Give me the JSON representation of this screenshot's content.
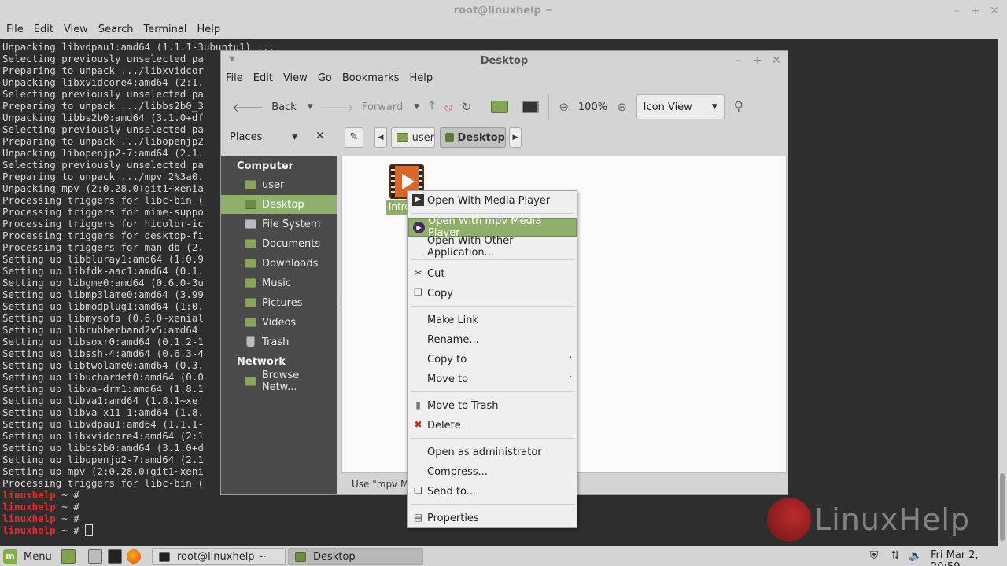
{
  "terminal": {
    "title": "root@linuxhelp ~",
    "menu": [
      "File",
      "Edit",
      "View",
      "Search",
      "Terminal",
      "Help"
    ],
    "lines": [
      "Unpacking libvdpau1:amd64 (1.1.1-3ubuntu1) ...",
      "Selecting previously unselected pa",
      "Preparing to unpack .../libxvidcor",
      "Unpacking libxvidcore4:amd64 (2:1.",
      "Selecting previously unselected pa",
      "Preparing to unpack .../libbs2b0_3",
      "Unpacking libbs2b0:amd64 (3.1.0+df",
      "Selecting previously unselected pa",
      "Preparing to unpack .../libopenjp2",
      "Unpacking libopenjp2-7:amd64 (2.1.",
      "Selecting previously unselected pa",
      "Preparing to unpack .../mpv_2%3a0.",
      "Unpacking mpv (2:0.28.0+git1~xenia",
      "Processing triggers for libc-bin (",
      "Processing triggers for mime-suppo",
      "Processing triggers for hicolor-ic",
      "Processing triggers for desktop-fi",
      "Processing triggers for man-db (2.",
      "Setting up libbluray1:amd64 (1:0.9",
      "Setting up libfdk-aac1:amd64 (0.1.",
      "Setting up libgme0:amd64 (0.6.0-3u",
      "Setting up libmp3lame0:amd64 (3.99",
      "Setting up libmodplug1:amd64 (1:0.",
      "Setting up libmysofa (0.6.0~xenial",
      "Setting up librubberband2v5:amd64 ",
      "Setting up libsoxr0:amd64 (0.1.2-1",
      "Setting up libssh-4:amd64 (0.6.3-4",
      "Setting up libtwolame0:amd64 (0.3.",
      "Setting up libuchardet0:amd64 (0.0",
      "Setting up libva-drm1:amd64 (1.8.1",
      "Setting up libva1:amd64 (1.8.1~xe",
      "Setting up libva-x11-1:amd64 (1.8.",
      "Setting up libvdpau1:amd64 (1.1.1-",
      "Setting up libxvidcore4:amd64 (2:1",
      "Setting up libbs2b0:amd64 (3.1.0+d",
      "Setting up libopenjp2-7:amd64 (2.1",
      "Setting up mpv (2:0.28.0+git1~xeni",
      "Processing triggers for libc-bin ("
    ],
    "prompt_user": "linuxhelp",
    "prompt_tail": " ~ #"
  },
  "file_manager": {
    "title": "Desktop",
    "menu": [
      "File",
      "Edit",
      "View",
      "Go",
      "Bookmarks",
      "Help"
    ],
    "toolbar": {
      "back": "Back",
      "forward": "Forward",
      "zoom": "100%",
      "view_mode": "Icon View"
    },
    "places_label": "Places",
    "breadcrumbs": [
      "user",
      "Desktop"
    ],
    "sidebar": {
      "computer_heading": "Computer",
      "computer_items": [
        "user",
        "Desktop",
        "File System",
        "Documents",
        "Downloads",
        "Music",
        "Pictures",
        "Videos",
        "Trash"
      ],
      "network_heading": "Network",
      "network_items": [
        "Browse Netw..."
      ]
    },
    "file_label": "intro",
    "status": "Use \"mpv Me"
  },
  "context_menu": {
    "items": [
      "Open With Media Player",
      "Open With mpv Media Player",
      "Open With Other Application...",
      "Cut",
      "Copy",
      "Make Link",
      "Rename...",
      "Copy to",
      "Move to",
      "Move to Trash",
      "Delete",
      "Open as administrator",
      "Compress...",
      "Send to...",
      "Properties"
    ],
    "highlighted": "Open With mpv Media Player"
  },
  "watermark": {
    "text": "LinuxHelp"
  },
  "taskbar": {
    "menu_label": "Menu",
    "windows": [
      "root@linuxhelp ~",
      "Desktop"
    ],
    "clock": "Fri Mar  2, 20:59"
  },
  "colors": {
    "accent": "#8fb06b",
    "terminal_bg": "#2e2e2e",
    "prompt": "#ef2929"
  }
}
